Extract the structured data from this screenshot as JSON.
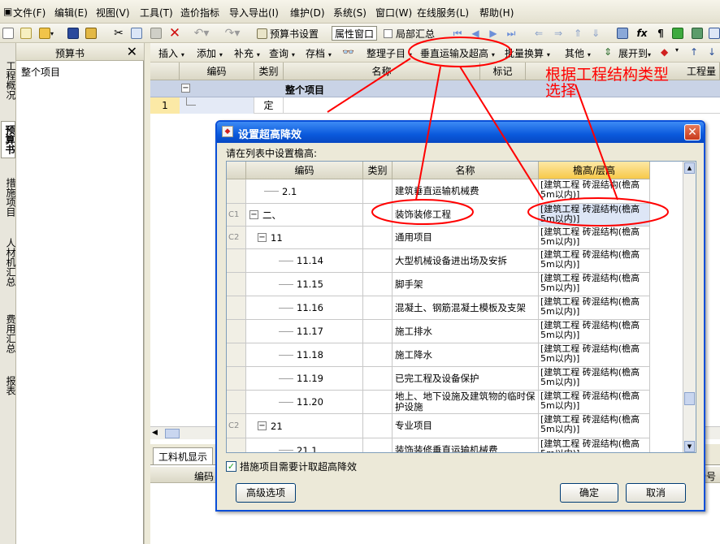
{
  "menu": [
    "文件(F)",
    "编辑(E)",
    "视图(V)",
    "工具(T)",
    "造价指标",
    "导入导出(I)",
    "维护(D)",
    "系统(S)",
    "窗口(W)",
    "在线服务(L)",
    "帮助(H)"
  ],
  "toolbar": {
    "budget_setting": "预算书设置",
    "prop_window": "属性窗口",
    "local_summary": "局部汇总"
  },
  "left_tabs": [
    "工程概况",
    "预算书",
    "措施项目",
    "人材机汇总",
    "费用汇总",
    "报表"
  ],
  "panel": {
    "title": "预算书",
    "item": "整个项目"
  },
  "toolbar2": [
    "插入",
    "添加",
    "补充",
    "查询",
    "存档",
    "整理子目",
    "垂直运输及超高",
    "批量换算",
    "其他",
    "展开到"
  ],
  "grid": {
    "headers": [
      "编码",
      "类别",
      "名称",
      "标记",
      "工程量"
    ],
    "group_label": "整个项目",
    "row_num": "1",
    "row_type": "定"
  },
  "bottom_tab": "工料机显示",
  "bottom_headers": [
    "编码",
    "场号"
  ],
  "dialog": {
    "title": "设置超高降效",
    "prompt": "请在列表中设置檐高:",
    "headers": [
      "编码",
      "类别",
      "名称",
      "檐高/层高"
    ],
    "rows": [
      {
        "label": "",
        "code": "2.1",
        "name": "建筑垂直运输机械费",
        "height": "[建筑工程 砖混结构(檐高5m以内)]"
      },
      {
        "label": "C1",
        "code": "二、",
        "name": "装饰装修工程",
        "height": "[建筑工程 砖混结构(檐高5m以内)]"
      },
      {
        "label": "C2",
        "code": "11",
        "name": "通用项目",
        "height": "[建筑工程 砖混结构(檐高5m以内)]"
      },
      {
        "label": "",
        "code": "11.14",
        "name": "大型机械设备进出场及安拆",
        "height": "[建筑工程 砖混结构(檐高5m以内)]"
      },
      {
        "label": "",
        "code": "11.15",
        "name": "脚手架",
        "height": "[建筑工程 砖混结构(檐高5m以内)]"
      },
      {
        "label": "",
        "code": "11.16",
        "name": "混凝土、钢筋混凝土模板及支架",
        "height": "[建筑工程 砖混结构(檐高5m以内)]"
      },
      {
        "label": "",
        "code": "11.17",
        "name": "施工排水",
        "height": "[建筑工程 砖混结构(檐高5m以内)]"
      },
      {
        "label": "",
        "code": "11.18",
        "name": "施工降水",
        "height": "[建筑工程 砖混结构(檐高5m以内)]"
      },
      {
        "label": "",
        "code": "11.19",
        "name": "已完工程及设备保护",
        "height": "[建筑工程 砖混结构(檐高5m以内)]"
      },
      {
        "label": "",
        "code": "11.20",
        "name": "地上、地下设施及建筑物的临时保护设施",
        "height": "[建筑工程 砖混结构(檐高5m以内)]"
      },
      {
        "label": "C2",
        "code": "21",
        "name": "专业项目",
        "height": "[建筑工程 砖混结构(檐高5m以内)]"
      },
      {
        "label": "",
        "code": "21.1",
        "name": "装饰装修垂直运输机械费",
        "height": "[建筑工程 砖混结构(檐高5m以内)]"
      }
    ],
    "checkbox": "措施项目需要计取超高降效",
    "advanced": "高级选项",
    "ok": "确定",
    "cancel": "取消"
  },
  "annotation": [
    "根据工程结构类型",
    "选择"
  ],
  "colors": {
    "accent": "#0a59dc",
    "highlight": "#fbe9a6",
    "annotation": "#ff0000"
  }
}
